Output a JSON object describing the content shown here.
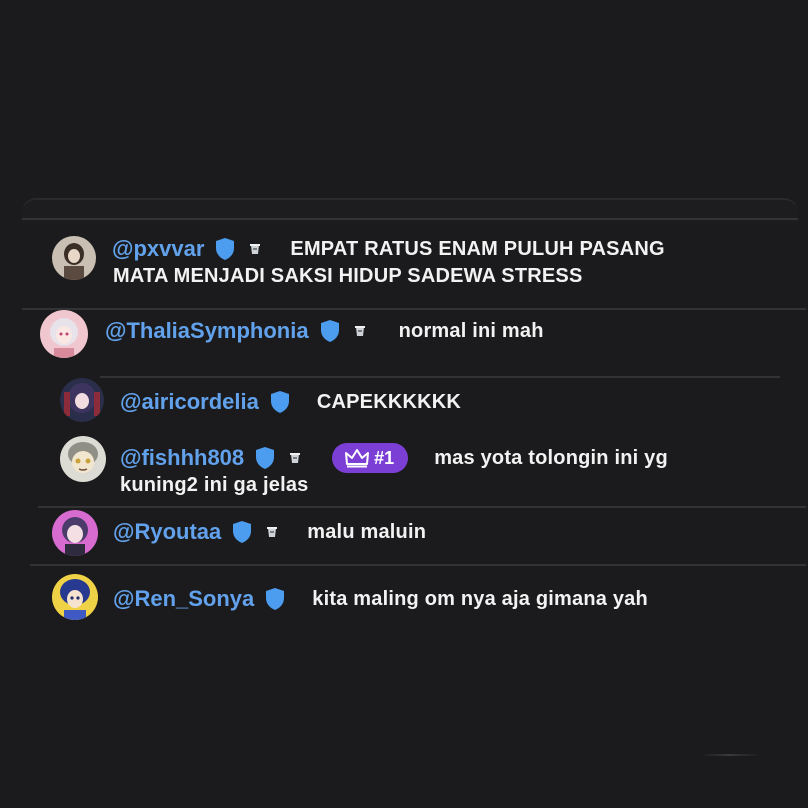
{
  "comments": [
    {
      "username": "@pxvvar",
      "message_line1": "EMPAT RATUS ENAM PULUH PASANG",
      "message_line2": "MATA MENJADI SAKSI HIDUP SADEWA STRESS",
      "verified": true,
      "cup_badge": true
    },
    {
      "username": "@ThaliaSymphonia",
      "message": "normal ini mah",
      "verified": true,
      "cup_badge": true
    },
    {
      "username": "@airicordelia",
      "message": "CAPEKKKKKK",
      "verified": true,
      "cup_badge": false
    },
    {
      "username": "@fishhh808",
      "rank_badge": "#1",
      "message_line1": "mas yota tolongin ini yg",
      "message_line2": "kuning2 ini ga jelas",
      "verified": true,
      "cup_badge": true
    },
    {
      "username": "@Ryoutaa",
      "message": "malu maluin",
      "verified": true,
      "cup_badge": true
    },
    {
      "username": "@Ren_Sonya",
      "message": "kita maling om nya aja gimana yah",
      "verified": true,
      "cup_badge": false
    }
  ],
  "icons": {
    "verified": "shield-icon",
    "cup": "cup-icon",
    "rank": "crown-icon"
  },
  "colors": {
    "background": "#1b1b1d",
    "username": "#62a2ec",
    "message": "#f2f2f2",
    "verified_badge": "#4c9cf0",
    "rank_badge": "#7b3fd6"
  }
}
